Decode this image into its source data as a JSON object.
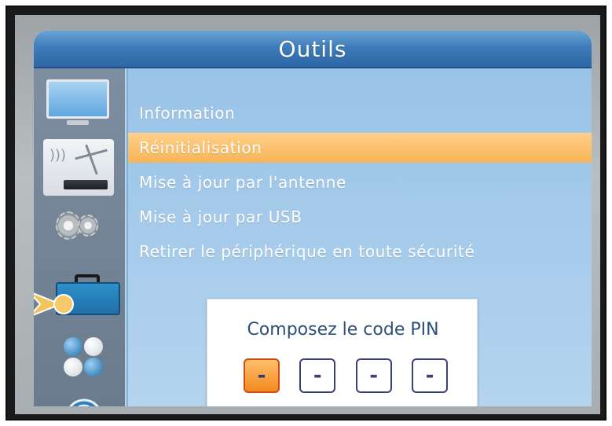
{
  "window": {
    "title": "Outils"
  },
  "rail": {
    "icons": [
      "tv-icon",
      "antenna-icon",
      "gears-icon",
      "toolbox-icon",
      "balls-icon",
      "disc-icon"
    ],
    "selected_icon": "toolbox-icon"
  },
  "menu": {
    "items": [
      {
        "label": "Information"
      },
      {
        "label": "Réinitialisation"
      },
      {
        "label": "Mise à jour par l'antenne"
      },
      {
        "label": "Mise à jour par USB"
      },
      {
        "label": "Retirer le périphérique en toute sécurité"
      }
    ],
    "selected_index": 1
  },
  "pin_dialog": {
    "prompt": "Composez le code PIN",
    "digits": [
      "-",
      "-",
      "-",
      "-"
    ],
    "active_digit": 0
  },
  "colors": {
    "title_bar": "#3f7cba",
    "panel": "#a9cdec",
    "selection": "#f8b458",
    "pin_active": "#f28a1e",
    "pin_border": "#3b3f7a"
  }
}
